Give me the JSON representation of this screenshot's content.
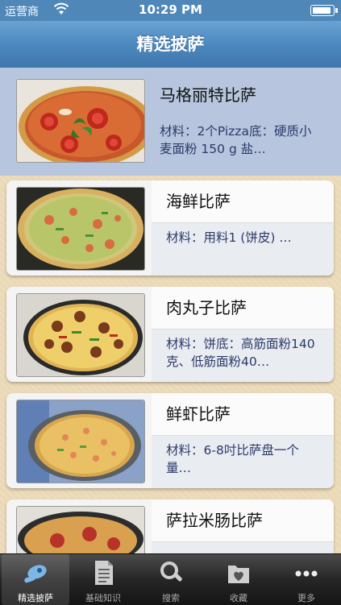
{
  "status": {
    "carrier": "运营商",
    "time": "10:29 PM"
  },
  "nav": {
    "title": "精选披萨"
  },
  "items": [
    {
      "name": "马格丽特比萨",
      "desc": "材料：2个Pizza底：硬质小麦面粉 150 g 盐…",
      "thumb": "margherita-pizza-image"
    },
    {
      "name": "海鲜比萨",
      "desc": "材料：用料1 (饼皮) …",
      "thumb": "seafood-pizza-image"
    },
    {
      "name": "肉丸子比萨",
      "desc": "材料：饼底：高筋面粉140克、低筋面粉40…",
      "thumb": "meatball-pizza-image"
    },
    {
      "name": "鲜虾比萨",
      "desc": "材料：6-8吋比萨盘一个量…",
      "thumb": "shrimp-pizza-image"
    },
    {
      "name": "萨拉米肠比萨",
      "desc": "",
      "thumb": "salami-pizza-image"
    }
  ],
  "tabs": [
    {
      "label": "精选披萨",
      "icon": "pizza-cutter-icon",
      "active": true
    },
    {
      "label": "基础知识",
      "icon": "document-icon",
      "active": false
    },
    {
      "label": "搜索",
      "icon": "search-icon",
      "active": false
    },
    {
      "label": "收藏",
      "icon": "heart-folder-icon",
      "active": false
    },
    {
      "label": "更多",
      "icon": "more-icon",
      "active": false
    }
  ],
  "colors": {
    "navbar": "#4a86bd",
    "background": "#ead9b6",
    "selected_row": "#b7c6de",
    "description_text": "#2c3a6a",
    "tabbar": "#262626"
  }
}
